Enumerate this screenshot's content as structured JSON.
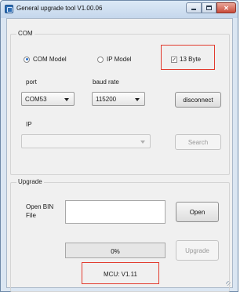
{
  "window": {
    "title": "General upgrade tool V1.00.06",
    "controls": {
      "minimize": "–",
      "maximize": "□",
      "close": "✕"
    }
  },
  "com_group": {
    "title": "COM",
    "mode_com": {
      "label": "COM Model",
      "selected": true
    },
    "mode_ip": {
      "label": "IP Model",
      "selected": false
    },
    "byte13": {
      "label": "13 Byte",
      "checked": true,
      "check_glyph": "☑"
    },
    "port_label": "port",
    "baud_label": "baud rate",
    "port_value": "COM53",
    "baud_value": "115200",
    "disconnect_label": "disconnect",
    "ip_label": "IP",
    "ip_value": "",
    "search_label": "Search"
  },
  "upgrade_group": {
    "title": "Upgrade",
    "open_bin_label": "Open BIN\nFile",
    "file_path": "",
    "open_label": "Open",
    "progress_text": "0%",
    "progress_fraction": 0,
    "upgrade_label": "Upgrade"
  },
  "status": {
    "mcu_version": "MCU: V1.11"
  },
  "colors": {
    "highlight_box": "#e23b2e",
    "title_bar": "#c5d7ec",
    "radio_selected": "#2a6fc9"
  },
  "icons": [
    "app-icon",
    "minimize-icon",
    "maximize-icon",
    "close-icon",
    "dropdown-arrow-icon"
  ]
}
